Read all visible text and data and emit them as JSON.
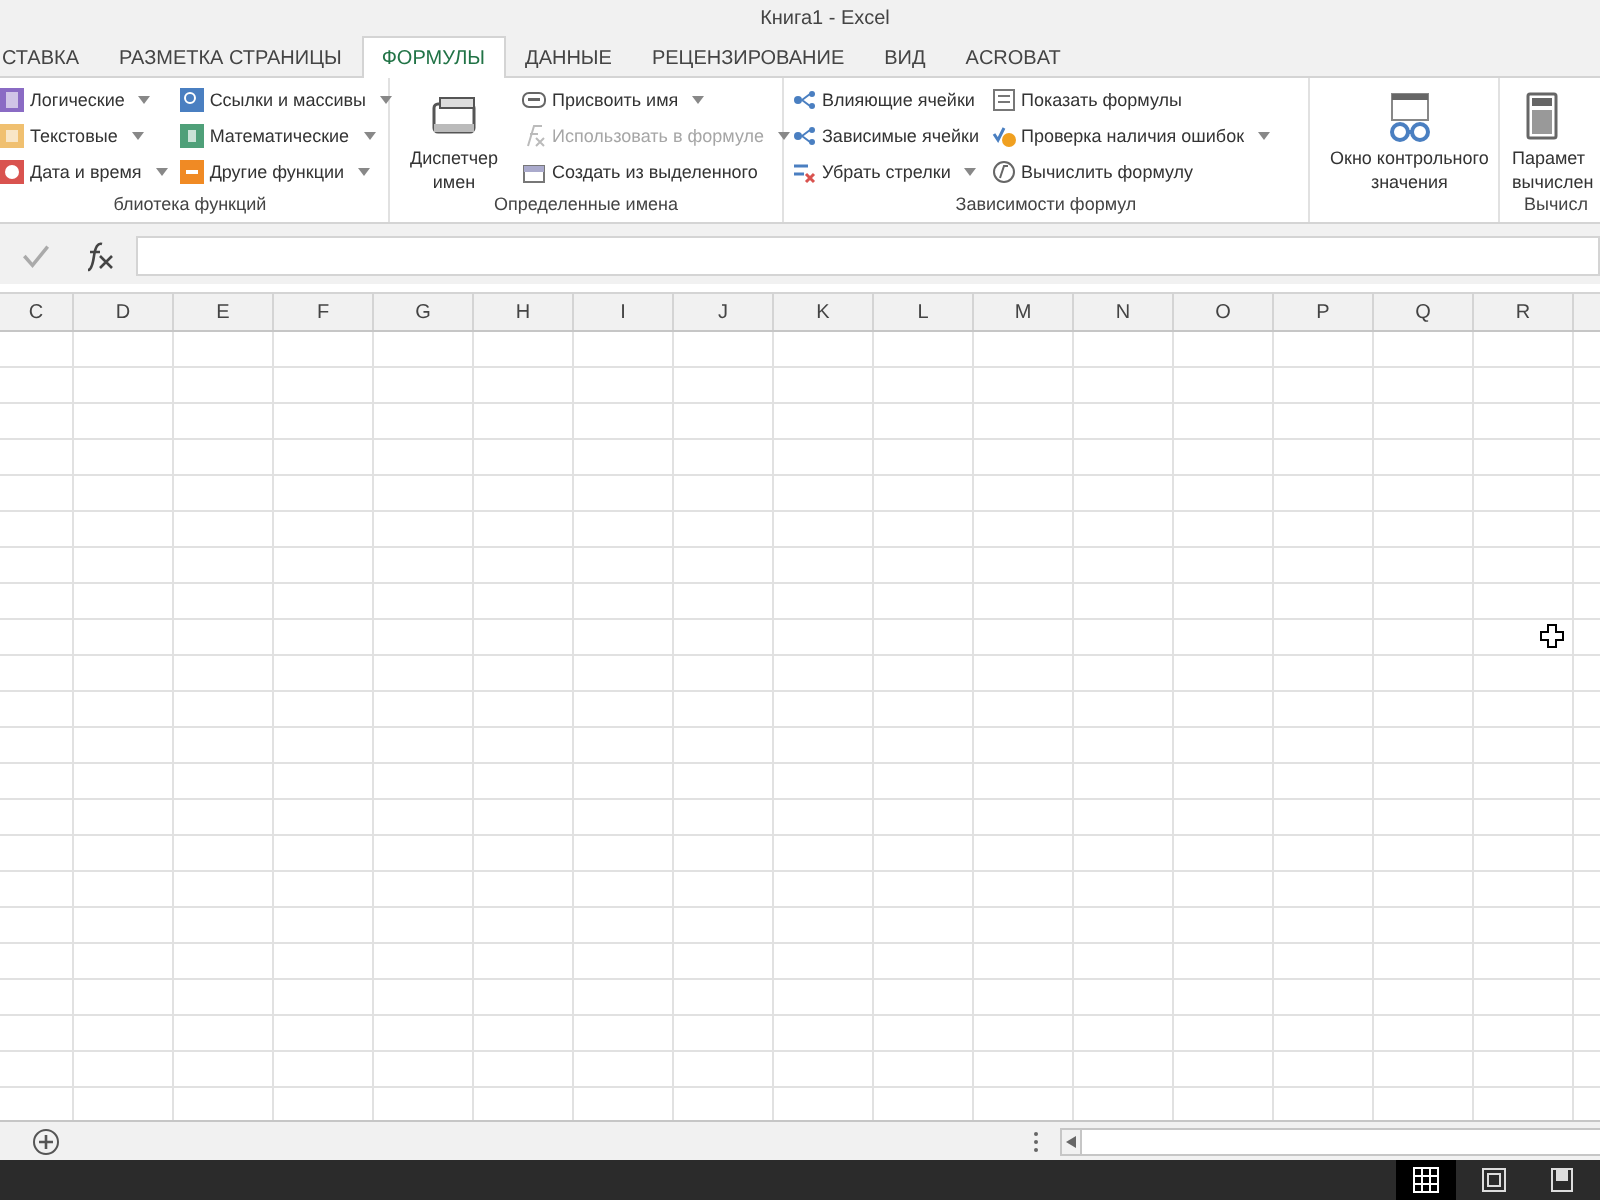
{
  "window": {
    "title": "Книга1 - Excel"
  },
  "tabs": [
    {
      "label": "СТАВКА",
      "selected": false
    },
    {
      "label": "РАЗМЕТКА СТРАНИЦЫ",
      "selected": false
    },
    {
      "label": "ФОРМУЛЫ",
      "selected": true
    },
    {
      "label": "ДАННЫЕ",
      "selected": false
    },
    {
      "label": "РЕЦЕНЗИРОВАНИЕ",
      "selected": false
    },
    {
      "label": "ВИД",
      "selected": false
    },
    {
      "label": "ACROBAT",
      "selected": false
    }
  ],
  "ribbon": {
    "groups": [
      {
        "label": "блиотека функций",
        "columns": [
          [
            {
              "label": "Логические",
              "dropdown": true,
              "disabled": false
            },
            {
              "label": "Текстовые",
              "dropdown": true,
              "disabled": false
            },
            {
              "label": "Дата и время",
              "dropdown": true,
              "disabled": false
            }
          ],
          [
            {
              "label": "Ссылки и массивы",
              "dropdown": true,
              "disabled": false
            },
            {
              "label": "Математические",
              "dropdown": true,
              "disabled": false
            },
            {
              "label": "Другие функции",
              "dropdown": true,
              "disabled": false
            }
          ]
        ]
      },
      {
        "label": "Определенные имена",
        "large": [
          {
            "lines": [
              "Диспетчер",
              "имен"
            ]
          }
        ],
        "columns": [
          [
            {
              "label": "Присвоить имя",
              "dropdown": true,
              "disabled": false
            },
            {
              "label": "Использовать в формуле",
              "dropdown": true,
              "disabled": true
            },
            {
              "label": "Создать из выделенного",
              "dropdown": false,
              "disabled": false
            }
          ]
        ]
      },
      {
        "label": "Зависимости формул",
        "columns": [
          [
            {
              "label": "Влияющие ячейки",
              "dropdown": false,
              "disabled": false
            },
            {
              "label": "Зависимые ячейки",
              "dropdown": false,
              "disabled": false
            },
            {
              "label": "Убрать стрелки",
              "dropdown": true,
              "disabled": false
            }
          ],
          [
            {
              "label": "Показать формулы",
              "dropdown": false,
              "disabled": false
            },
            {
              "label": "Проверка наличия ошибок",
              "dropdown": true,
              "disabled": false
            },
            {
              "label": "Вычислить формулу",
              "dropdown": false,
              "disabled": false
            }
          ]
        ]
      },
      {
        "large": [
          {
            "lines": [
              "Окно контрольного",
              "значения"
            ]
          }
        ]
      },
      {
        "label": "Вычисл",
        "large": [
          {
            "lines": [
              "Парамет",
              "вычислен"
            ]
          }
        ]
      }
    ]
  },
  "columns": [
    "C",
    "D",
    "E",
    "F",
    "G",
    "H",
    "I",
    "J",
    "K",
    "L",
    "M",
    "N",
    "O",
    "P",
    "Q",
    "R"
  ],
  "views": [
    {
      "kind": "normal",
      "selected": true
    },
    {
      "kind": "layout",
      "selected": false
    },
    {
      "kind": "break",
      "selected": false
    }
  ]
}
